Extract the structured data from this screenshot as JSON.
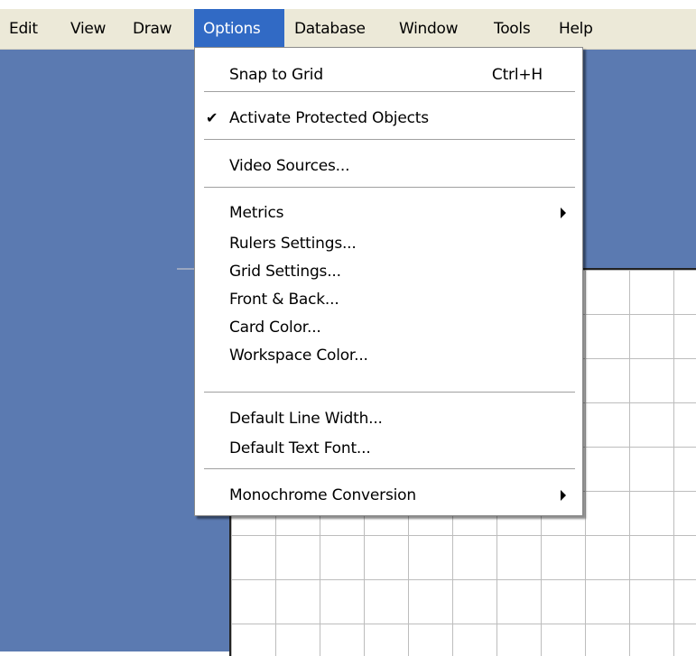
{
  "menubar": {
    "items": [
      {
        "label": "Edit"
      },
      {
        "label": "View"
      },
      {
        "label": "Draw"
      },
      {
        "label": "Options",
        "active": true
      },
      {
        "label": "Database"
      },
      {
        "label": "Window"
      },
      {
        "label": "Tools"
      },
      {
        "label": "Help"
      }
    ]
  },
  "options_menu": {
    "snap_to_grid": {
      "label": "Snap to Grid",
      "shortcut": "Ctrl+H"
    },
    "activate_protected": {
      "label": "Activate Protected Objects",
      "checked": true,
      "check_glyph": "✔"
    },
    "video_sources": {
      "label": "Video Sources..."
    },
    "metrics": {
      "label": "Metrics",
      "submenu": true
    },
    "rulers_settings": {
      "label": "Rulers Settings..."
    },
    "grid_settings": {
      "label": "Grid Settings..."
    },
    "front_back": {
      "label": "Front & Back..."
    },
    "card_color": {
      "label": "Card Color..."
    },
    "workspace_color": {
      "label": "Workspace Color..."
    },
    "default_line_width": {
      "label": "Default Line Width..."
    },
    "default_text_font": {
      "label": "Default Text Font..."
    },
    "monochrome_conversion": {
      "label": "Monochrome Conversion",
      "submenu": true
    }
  },
  "colors": {
    "workspace": "#5b7ab1",
    "menubar": "#ece9d8",
    "highlight": "#316ac5",
    "card": "#ffffff",
    "grid": "#bdbdbd"
  }
}
